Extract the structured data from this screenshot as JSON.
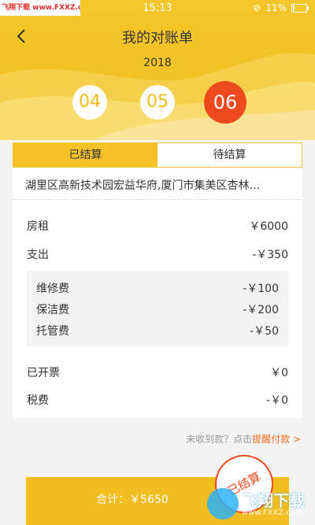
{
  "status_bar": {
    "watermark": "飞翔下载 www.FXXZ.com",
    "time": "15:13",
    "battery": "11%",
    "battery_level": 0.11
  },
  "header": {
    "title": "我的对账单",
    "year": "2018",
    "months": [
      "04",
      "05",
      "06"
    ],
    "selected_month": "06"
  },
  "tabs": {
    "settled": "已结算",
    "pending": "待结算"
  },
  "address": "湖里区高新技术园宏益华府,厦门市集美区杏林…",
  "rows": {
    "rent": {
      "label": "房租",
      "value": "￥6000"
    },
    "expense": {
      "label": "支出",
      "value": "-￥350"
    },
    "repair": {
      "label": "维修费",
      "value": "-￥100"
    },
    "cleaning": {
      "label": "保洁费",
      "value": "-￥200"
    },
    "custody": {
      "label": "托管费",
      "value": "-￥50"
    },
    "invoiced": {
      "label": "已开票",
      "value": "￥0"
    },
    "tax": {
      "label": "税费",
      "value": "-￥0"
    }
  },
  "reminder": {
    "prefix": "未收到款？点击",
    "link": "提醒付款",
    "arrow": ">"
  },
  "total": {
    "label": "合计：",
    "amount": "￥5650"
  },
  "stamp": "已结算",
  "watermark": {
    "text": "飞翔下载",
    "url": "www.FXXZ.com"
  },
  "colors": {
    "accent": "#f2bd21",
    "highlight": "#ee4a1f"
  }
}
